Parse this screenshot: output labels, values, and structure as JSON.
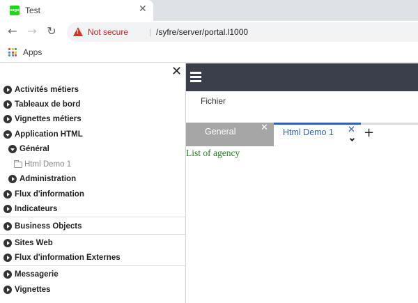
{
  "browser": {
    "tab_title": "Test",
    "favicon_text": "sage",
    "close_glyph": "✕",
    "nav": {
      "back": "←",
      "forward": "→",
      "reload": "↻"
    },
    "security_label": "Not secure",
    "url_separator": "|",
    "url": "/syfre/server/portal.l1000",
    "bookmarks": {
      "apps_label": "Apps",
      "apps_colors": [
        "#ea4335",
        "#fbbc05",
        "#34a853",
        "#4285f4",
        "#ea4335",
        "#fbbc05",
        "#34a853",
        "#4285f4",
        "#ea4335"
      ]
    }
  },
  "sidebar": {
    "close_glyph": "✕",
    "items": [
      {
        "label": "Activités métiers",
        "icon": "chevron-right-circle-icon"
      },
      {
        "label": "Tableaux de bord",
        "icon": "chevron-right-circle-icon"
      },
      {
        "label": "Vignettes métiers",
        "icon": "chevron-right-circle-icon"
      },
      {
        "label": "Application HTML",
        "icon": "chevron-down-circle-icon"
      },
      {
        "label": "Général",
        "icon": "chevron-down-circle-icon"
      },
      {
        "label": "Html Demo 1",
        "icon": "folder-icon"
      },
      {
        "label": "Administration",
        "icon": "chevron-right-circle-icon"
      },
      {
        "label": "Flux d'information",
        "icon": "chevron-right-circle-icon"
      },
      {
        "label": "Indicateurs",
        "icon": "chevron-right-circle-icon"
      },
      {
        "label": "Business Objects",
        "icon": "chevron-right-circle-icon"
      },
      {
        "label": "Sites Web",
        "icon": "chevron-right-circle-icon"
      },
      {
        "label": "Flux d'information Externes",
        "icon": "chevron-right-circle-icon"
      },
      {
        "label": "Messagerie",
        "icon": "chevron-right-circle-icon"
      },
      {
        "label": "Vignettes",
        "icon": "chevron-right-circle-icon"
      }
    ]
  },
  "main": {
    "menu": {
      "fichier": "Fichier"
    },
    "tabs": [
      {
        "label": "General",
        "close": "✕",
        "active": false
      },
      {
        "label": "Html Demo 1",
        "close": "✕",
        "active": true
      }
    ],
    "add_tab": "+",
    "content_title": "List of agency"
  },
  "colors": {
    "topbar": "#3a3f4b",
    "active_tab_accent": "#2d5fb3",
    "inactive_tab": "#a6a6a6",
    "content_title": "#178617",
    "not_secure": "#c5221f"
  }
}
